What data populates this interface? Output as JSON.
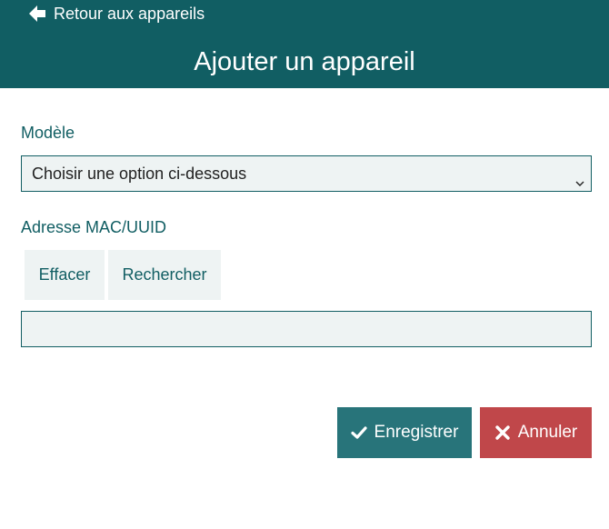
{
  "header": {
    "back_label": "Retour aux appareils",
    "title": "Ajouter un appareil"
  },
  "form": {
    "model_label": "Modèle",
    "model_select_value": "Choisir une option ci-dessous",
    "mac_label": "Adresse MAC/UUID",
    "clear_button": "Effacer",
    "search_button": "Rechercher",
    "mac_input_value": ""
  },
  "actions": {
    "save_label": "Enregistrer",
    "cancel_label": "Annuler"
  },
  "icons": {
    "back": "arrow-left-icon",
    "select": "chevron-down-icon",
    "save": "check-icon",
    "cancel": "close-icon"
  },
  "colors": {
    "primary": "#115e63",
    "save": "#28747a",
    "cancel": "#c0474a",
    "field_bg": "#eef3f3"
  }
}
